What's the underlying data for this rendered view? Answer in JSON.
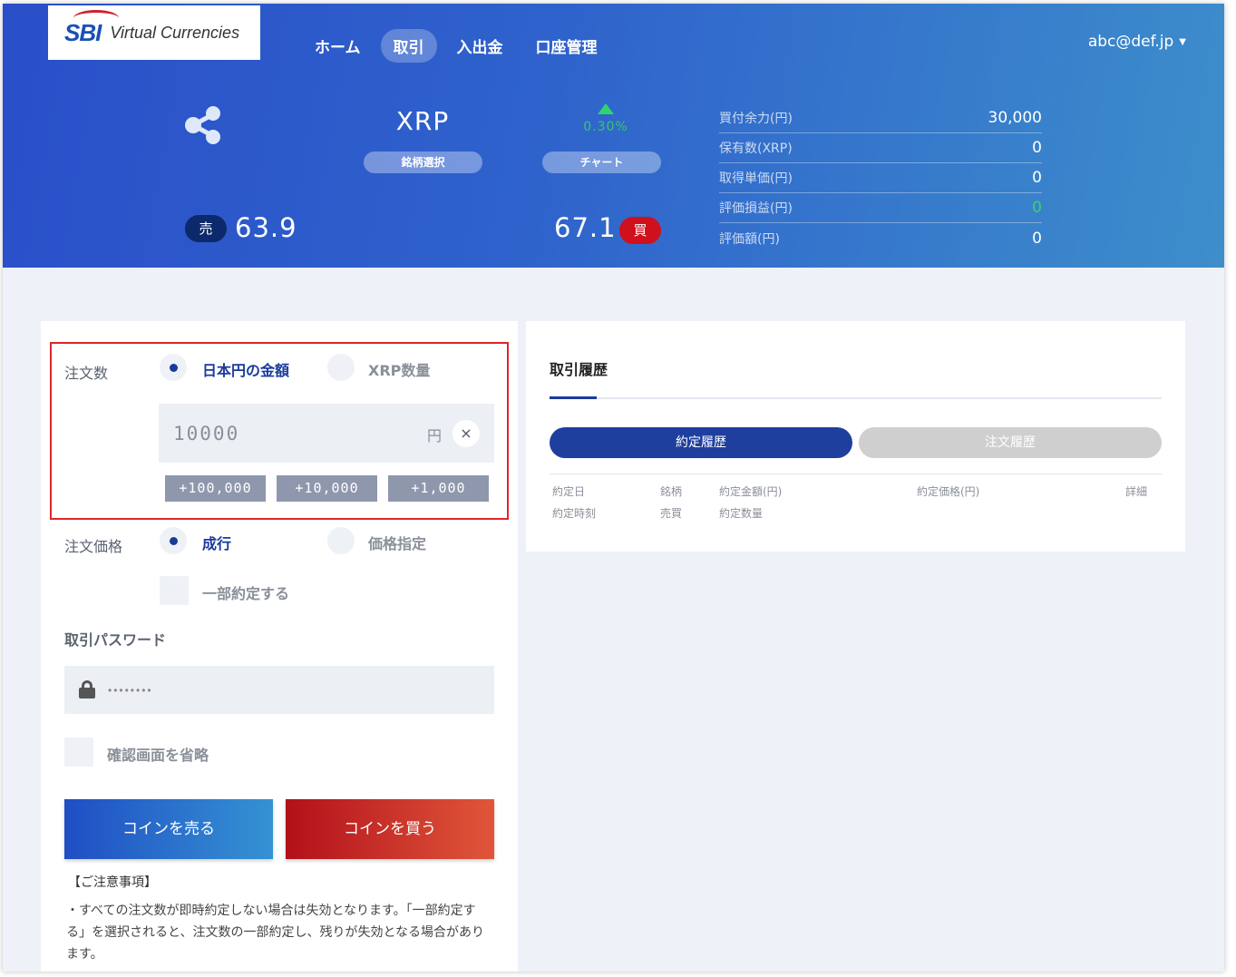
{
  "brand": {
    "logo_text": "SBI",
    "sub_text": "Virtual Currencies"
  },
  "nav": {
    "items": [
      "ホーム",
      "取引",
      "入出金",
      "口座管理"
    ]
  },
  "user": {
    "email": "abc@def.jp"
  },
  "coin": {
    "name": "XRP",
    "select_label": "銘柄選択",
    "chart_label": "チャート",
    "change_pct": "0.30%"
  },
  "prices": {
    "sell_label": "売",
    "sell_value": "63.9",
    "buy_value": "67.1",
    "buy_label": "買"
  },
  "account": {
    "rows": [
      {
        "label": "買付余力(円)",
        "value": "30,000"
      },
      {
        "label": "保有数(XRP)",
        "value": "0"
      },
      {
        "label": "取得単価(円)",
        "value": "0"
      },
      {
        "label": "評価損益(円)",
        "value": "0"
      },
      {
        "label": "評価額(円)",
        "value": "0"
      }
    ]
  },
  "order": {
    "qty_label": "注文数",
    "qty_option_yen": "日本円の金額",
    "qty_option_coin": "XRP数量",
    "amount_value": "10000",
    "amount_unit": "円",
    "clear_symbol": "×",
    "quick_buttons": [
      "+100,000",
      "+10,000",
      "+1,000"
    ],
    "price_label": "注文価格",
    "price_option_market": "成行",
    "price_option_limit": "価格指定",
    "partial_label": "一部約定する",
    "password_label": "取引パスワード",
    "password_value": "••••••••",
    "skip_confirm_label": "確認画面を省略",
    "sell_button": "コインを売る",
    "buy_button": "コインを買う",
    "notes_title": "【ご注意事項】",
    "notes_body": "・すべての注文数が即時約定しない場合は失効となります。「一部約定する」を選択されると、注文数の一部約定し、残りが失効となる場合があります。"
  },
  "history": {
    "title": "取引履歴",
    "tab_executed": "約定履歴",
    "tab_orders": "注文履歴",
    "columns": {
      "date": "約定日",
      "time": "約定時刻",
      "symbol": "銘柄",
      "side": "売買",
      "amount": "約定金額(円)",
      "qty": "約定数量",
      "price": "約定価格(円)",
      "detail": "詳細"
    }
  },
  "colors": {
    "header_start": "#2a4fc9",
    "header_end": "#3d8ecb",
    "sell": "#1f4ec4",
    "buy": "#d0101c",
    "up": "#2fd46d"
  }
}
